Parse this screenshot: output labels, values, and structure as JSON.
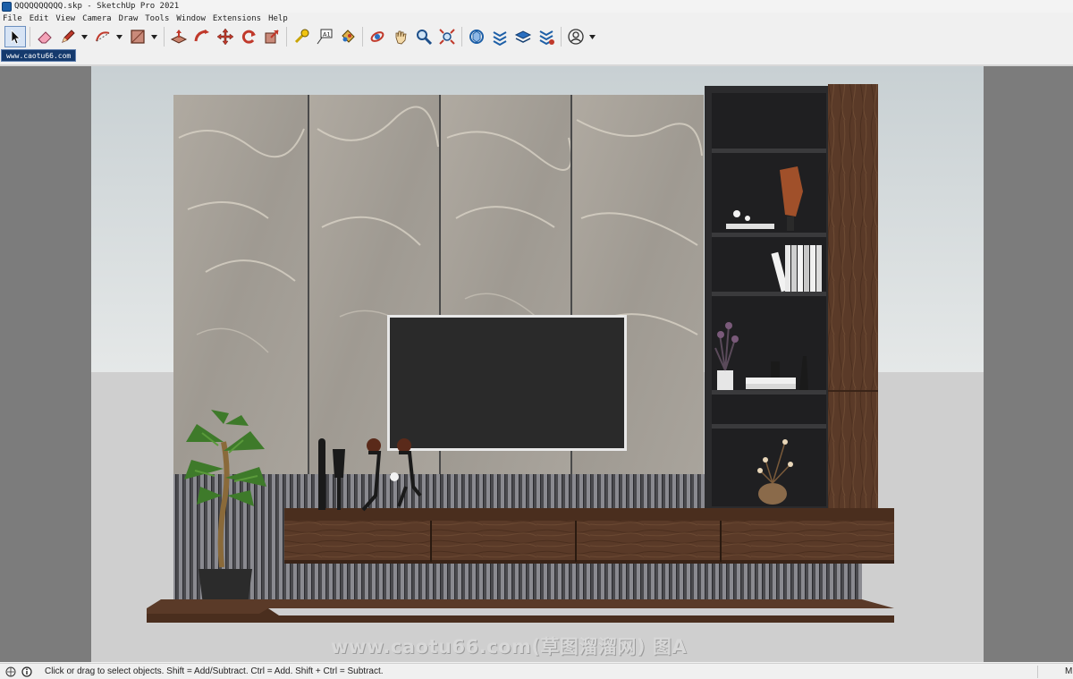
{
  "window": {
    "title": "QQQQQQQQQQ.skp - SketchUp Pro 2021"
  },
  "menubar": {
    "items": [
      "File",
      "Edit",
      "View",
      "Camera",
      "Draw",
      "Tools",
      "Window",
      "Extensions",
      "Help"
    ]
  },
  "toolbar": {
    "tools": [
      {
        "name": "select-tool",
        "icon": "arrow-cursor-icon",
        "active": true
      },
      {
        "name": "eraser-tool",
        "icon": "eraser-icon"
      },
      {
        "name": "pencil-tool",
        "icon": "pencil-icon",
        "dropdown": true
      },
      {
        "name": "arc-tool",
        "icon": "arc-icon",
        "dropdown": true
      },
      {
        "name": "rectangle-tool",
        "icon": "rectangle-icon",
        "dropdown": true
      },
      {
        "name": "push-pull-tool",
        "icon": "push-pull-icon"
      },
      {
        "name": "follow-me-tool",
        "icon": "follow-me-icon"
      },
      {
        "name": "move-tool",
        "icon": "move-icon"
      },
      {
        "name": "rotate-tool",
        "icon": "rotate-icon"
      },
      {
        "name": "scale-tool",
        "icon": "scale-icon"
      },
      {
        "name": "tape-measure-tool",
        "icon": "tape-measure-icon"
      },
      {
        "name": "text-tool",
        "icon": "text-icon"
      },
      {
        "name": "paint-bucket-tool",
        "icon": "paint-bucket-icon"
      },
      {
        "name": "orbit-tool",
        "icon": "orbit-icon"
      },
      {
        "name": "pan-tool",
        "icon": "pan-hand-icon"
      },
      {
        "name": "zoom-tool",
        "icon": "zoom-icon"
      },
      {
        "name": "zoom-extents-tool",
        "icon": "zoom-extents-icon"
      },
      {
        "name": "3d-warehouse-tool",
        "icon": "warehouse-icon"
      },
      {
        "name": "extension-warehouse-tool",
        "icon": "extension-warehouse-icon"
      },
      {
        "name": "layout-tool",
        "icon": "layers-icon"
      },
      {
        "name": "extension-manager-tool",
        "icon": "extension-manager-icon"
      },
      {
        "name": "account-tool",
        "icon": "user-account-icon",
        "dropdown": true
      }
    ]
  },
  "scene": {
    "tab_label": "www.caotu66.com"
  },
  "viewport": {
    "watermark": "www.caotu66.com(草图溜溜网) 图A",
    "colors": {
      "background": "#7c7c7c",
      "sky": "#d6dcdf",
      "ground": "#cfcfcf",
      "marble": "#a8a39b",
      "walnut": "#5a3a28",
      "shelf_dark": "#2b2b2d",
      "tv_screen": "#2a2a2a"
    }
  },
  "statusbar": {
    "text": "Click or drag to select objects. Shift = Add/Subtract. Ctrl = Add. Shift + Ctrl = Subtract.",
    "measurements_label": "M"
  }
}
